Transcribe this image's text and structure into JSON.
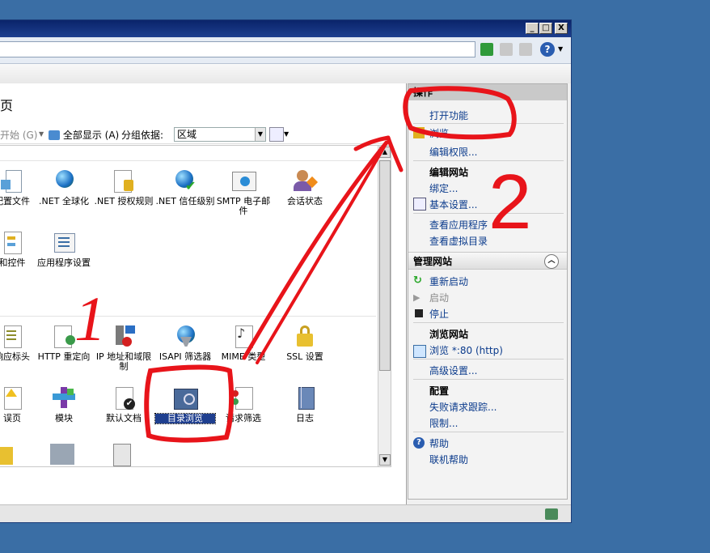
{
  "window": {
    "buttons": {
      "minimize": "_",
      "maximize": "□",
      "close": "X"
    }
  },
  "page": {
    "title_fragment": "页"
  },
  "toolbar": {
    "start_label": "开始 (G)",
    "show_all_label": "全部显示 (A)",
    "group_by_label": "分组依据:",
    "group_by_value": "区域"
  },
  "features": [
    {
      "label": "配置文件",
      "icon": "config-file-icon"
    },
    {
      "label": ".NET 全球化",
      "icon": "net-globalization-icon"
    },
    {
      "label": ".NET 授权规则",
      "icon": "net-authorization-icon"
    },
    {
      "label": ".NET 信任级别",
      "icon": "net-trust-icon"
    },
    {
      "label": "SMTP 电子邮件",
      "icon": "smtp-email-icon"
    },
    {
      "label": "会话状态",
      "icon": "session-state-icon"
    },
    {
      "label": "和控件",
      "icon": "controls-icon"
    },
    {
      "label": "应用程序设置",
      "icon": "app-settings-icon"
    },
    {
      "label": "响应标头",
      "icon": "response-headers-icon"
    },
    {
      "label": "HTTP 重定向",
      "icon": "http-redirect-icon"
    },
    {
      "label": "IP 地址和域限制",
      "icon": "ip-restriction-icon"
    },
    {
      "label": "ISAPI 筛选器",
      "icon": "isapi-filter-icon"
    },
    {
      "label": "MIME 类型",
      "icon": "mime-type-icon"
    },
    {
      "label": "SSL 设置",
      "icon": "ssl-lock-icon"
    },
    {
      "label": "误页",
      "icon": "error-page-icon"
    },
    {
      "label": "模块",
      "icon": "modules-icon"
    },
    {
      "label": "默认文档",
      "icon": "default-document-icon"
    },
    {
      "label": "目录浏览",
      "icon": "directory-browsing-icon"
    },
    {
      "label": "请求筛选",
      "icon": "request-filtering-icon"
    },
    {
      "label": "日志",
      "icon": "logging-icon"
    }
  ],
  "actions": {
    "header": "操作",
    "open_feature": "打开功能",
    "explore": "浏览",
    "edit_permissions": "编辑权限...",
    "edit_site_title": "编辑网站",
    "bindings": "绑定...",
    "basic_settings": "基本设置...",
    "view_applications": "查看应用程序",
    "view_virtual_dirs": "查看虚拟目录",
    "manage_site_title": "管理网站",
    "restart": "重新启动",
    "start": "启动",
    "stop": "停止",
    "browse_site_title": "浏览网站",
    "browse_port": "浏览 *:80 (http)",
    "advanced_settings": "高级设置...",
    "config_title": "配置",
    "failed_request_tracing": "失败请求跟踪...",
    "limits": "限制...",
    "help": "帮助",
    "online_help": "联机帮助"
  },
  "annotations": {
    "mark1": "1",
    "mark2": "2"
  },
  "colors": {
    "desktop": "#3a6ea5",
    "title_bar": "#0a246a",
    "link": "#0b3b8c",
    "annotation": "#e8141a",
    "selection": "#1f3f8f"
  }
}
